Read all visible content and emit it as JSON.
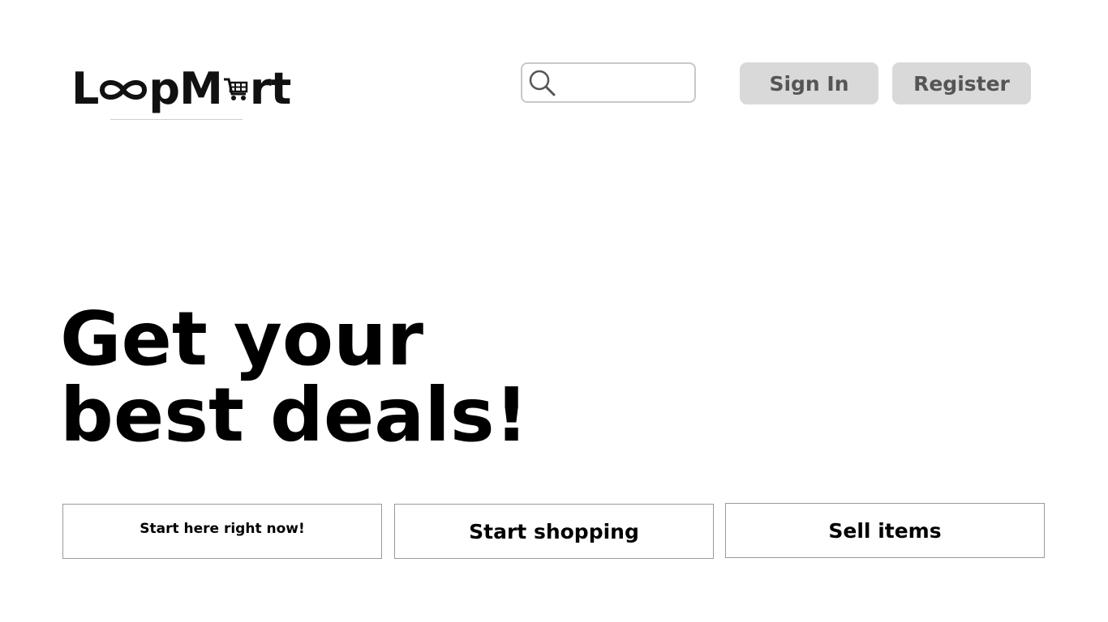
{
  "brand": {
    "logo_text_left": "L",
    "logo_text_mid": "pM",
    "logo_text_right": "rt",
    "logo_full": "LoopMart"
  },
  "header": {
    "search": {
      "placeholder": "",
      "value": ""
    },
    "signin_label": "Sign In",
    "register_label": "Register"
  },
  "hero": {
    "line1": "Get your",
    "line2": "best deals!"
  },
  "cta": {
    "start_here_label": "Start here right now!",
    "start_shopping_label": "Start shopping",
    "sell_items_label": "Sell items"
  },
  "colors": {
    "button_bg": "#d9d9d9",
    "button_text": "#555555",
    "border": "#9a9a9a"
  }
}
